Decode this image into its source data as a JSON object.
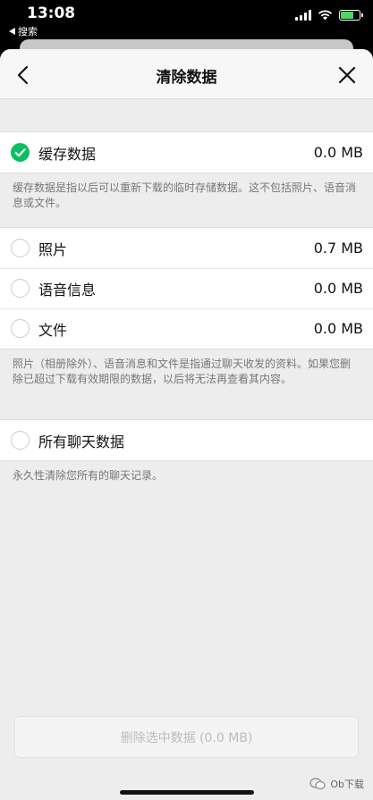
{
  "status_bar": {
    "time": "13:08",
    "back_app_label": "搜索"
  },
  "nav": {
    "title": "清除数据"
  },
  "cache": {
    "label": "缓存数据",
    "size": "0.0 MB",
    "checked": true,
    "note": "缓存数据是指以后可以重新下载的临时存储数据。这不包括照片、语音消息或文件。"
  },
  "files_group": {
    "items": [
      {
        "label": "照片",
        "size": "0.7 MB"
      },
      {
        "label": "语音信息",
        "size": "0.0 MB"
      },
      {
        "label": "文件",
        "size": "0.0 MB"
      }
    ],
    "note": "照片（相册除外）、语音消息和文件是指通过聊天收发的资料。如果您删除已超过下载有效期限的数据，以后将无法再查看其内容。"
  },
  "chat": {
    "label": "所有聊天数据",
    "note": "永久性清除您所有的聊天记录。"
  },
  "action": {
    "clear_label": "删除选中数据 (0.0 MB)"
  },
  "watermark": {
    "text": "Ob下载"
  },
  "colors": {
    "accent": "#07c160",
    "page_bg": "#ededed",
    "disabled_text": "#bcbcbc"
  },
  "icons": {
    "back": "chevron-left-icon",
    "close": "close-icon",
    "check": "checkmark-icon",
    "signal": "signal-icon",
    "wifi": "wifi-icon",
    "battery": "battery-icon"
  }
}
